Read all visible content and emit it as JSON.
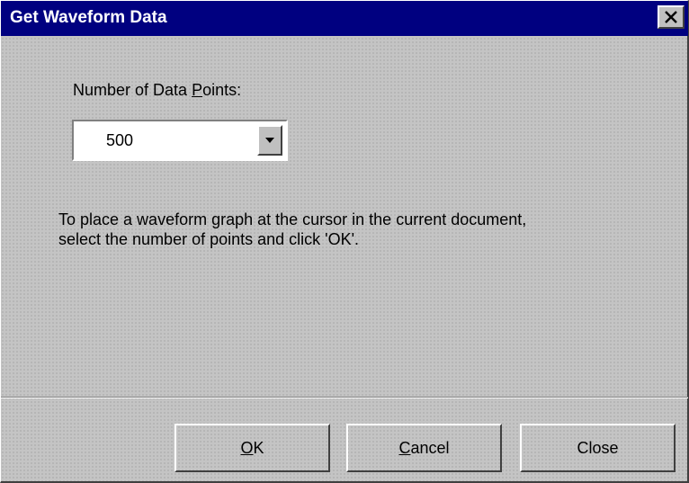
{
  "window": {
    "title": "Get Waveform Data",
    "close_icon": "close-x-icon"
  },
  "points": {
    "label_pre": "Number of Data ",
    "label_access": "P",
    "label_post": "oints:",
    "selected_value": "500",
    "dropdown_icon": "chevron-down-icon"
  },
  "instructions": {
    "line1": "To place a waveform graph at the cursor in the current document,",
    "line2": "select the number of points and click 'OK'."
  },
  "buttons": {
    "ok": {
      "access": "O",
      "rest": "K"
    },
    "cancel": {
      "access": "C",
      "rest": "ancel"
    },
    "close": {
      "label": "Close"
    }
  },
  "colors": {
    "titlebar": "#000080",
    "face": "#c0c0c0"
  }
}
